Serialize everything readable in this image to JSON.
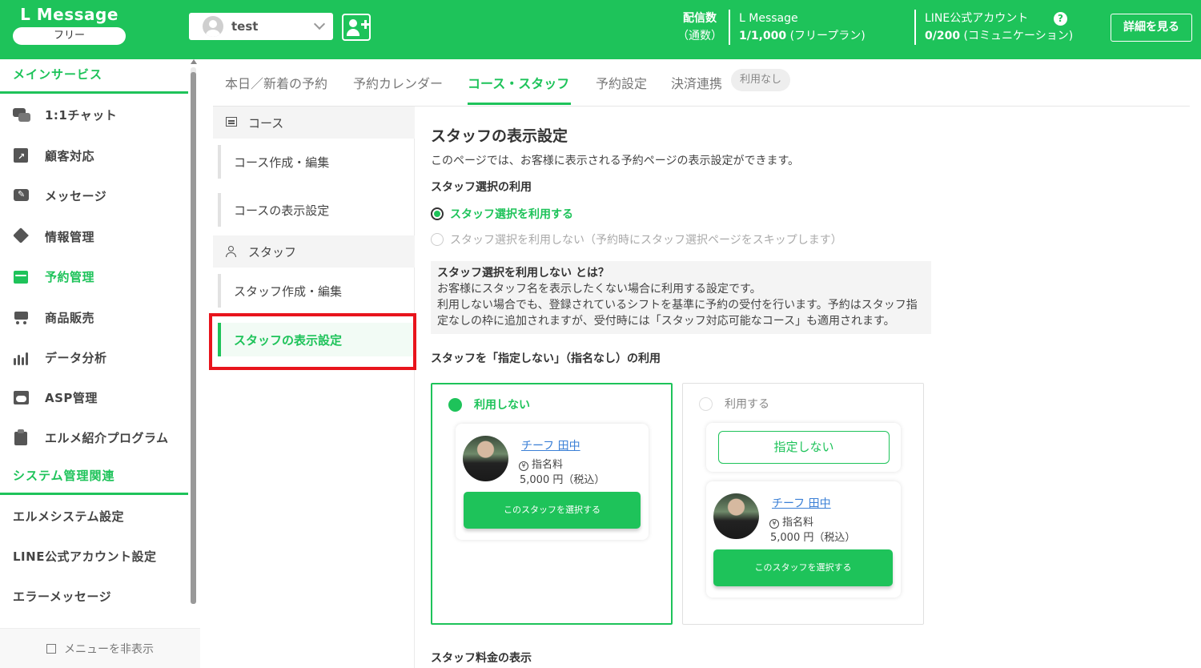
{
  "brand": {
    "title": "L Message",
    "plan_pill": "フリー"
  },
  "header": {
    "account_name": "test",
    "deliveries_label": "配信数",
    "deliveries_sub": "（通数）",
    "lmessage_label": "L Message",
    "lmessage_value": "1/1,000",
    "lmessage_plan": "(フリープラン)",
    "line_label": "LINE公式アカウント",
    "line_value": "0/200",
    "line_plan": "(コミュニケーション)",
    "help": "?",
    "detail_button": "詳細を見る"
  },
  "sidebar": {
    "section_main": "メインサービス",
    "items": [
      {
        "label": "1:1チャット",
        "icon": "chat-icon"
      },
      {
        "label": "顧客対応",
        "icon": "arrow-box-icon"
      },
      {
        "label": "メッセージ",
        "icon": "edit-message-icon"
      },
      {
        "label": "情報管理",
        "icon": "tag-icon"
      },
      {
        "label": "予約管理",
        "icon": "calendar-icon"
      },
      {
        "label": "商品販売",
        "icon": "cart-icon"
      },
      {
        "label": "データ分析",
        "icon": "bar-chart-icon"
      },
      {
        "label": "ASP管理",
        "icon": "asp-icon"
      },
      {
        "label": "エルメ紹介プログラム",
        "icon": "clipboard-icon"
      }
    ],
    "section_system": "システム管理関連",
    "system_items": [
      "エルメシステム設定",
      "LINE公式アカウント設定",
      "エラーメッセージ"
    ],
    "footer": "メニューを非表示"
  },
  "tabs": [
    "本日／新着の予約",
    "予約カレンダー",
    "コース・スタッフ",
    "予約設定",
    "決済連携"
  ],
  "tab_badge": "利用なし",
  "subnav": {
    "course_head": "コース",
    "course_items": [
      "コース作成・編集",
      "コースの表示設定"
    ],
    "staff_head": "スタッフ",
    "staff_items": [
      "スタッフ作成・編集",
      "スタッフの表示設定"
    ]
  },
  "main": {
    "title": "スタッフの表示設定",
    "description": "このページでは、お客様に表示される予約ページの表示設定ができます。",
    "staff_select_heading": "スタッフ選択の利用",
    "radio_use": "スタッフ選択を利用する",
    "radio_not_use": "スタッフ選択を利用しない（予約時にスタッフ選択ページをスキップします）",
    "note_title": "スタッフ選択を利用しない とは？",
    "note_line1": "お客様にスタッフ名を表示したくない場合に利用する設定です。",
    "note_line2": "利用しない場合でも、登録されているシフトを基準に予約の受付を行います。予約はスタッフ指",
    "note_line3": "定なしの枠に追加されますが、受付時には「スタッフ対応可能なコース」も適用されます。",
    "unassigned_heading": "スタッフを「指定しない」（指名なし）の利用",
    "option_off": "利用しない",
    "option_on": "利用する",
    "staff_name": "チーフ 田中",
    "fee_label": "指名料",
    "fee_value": "5,000 円（税込）",
    "select_button": "このスタッフを選択する",
    "unassigned_button": "指定しない",
    "fee_heading": "スタッフ料金の表示"
  },
  "colors": {
    "accent": "#1ec35a",
    "highlight": "#e8141c"
  }
}
